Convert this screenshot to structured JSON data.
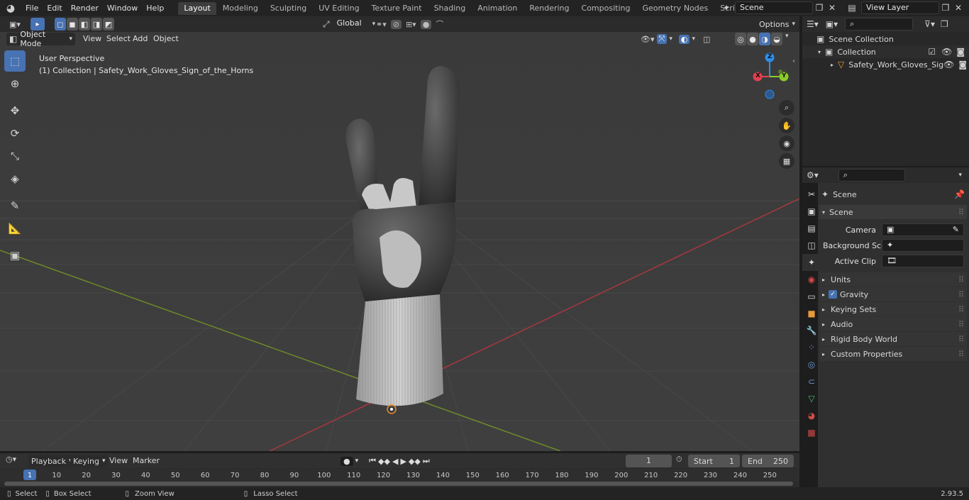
{
  "menubar": {
    "items": [
      "File",
      "Edit",
      "Render",
      "Window",
      "Help"
    ]
  },
  "workspaces": [
    "Layout",
    "Modeling",
    "Sculpting",
    "UV Editing",
    "Texture Paint",
    "Shading",
    "Animation",
    "Rendering",
    "Compositing",
    "Geometry Nodes",
    "Scripting"
  ],
  "active_workspace": "Layout",
  "scene_selector": "Scene",
  "view_layer": "View Layer",
  "viewport_header": {
    "mode": "Object Mode",
    "menus": [
      "View",
      "Select",
      "Add",
      "Object"
    ],
    "transform_orientation": "Global",
    "options": "Options"
  },
  "viewport": {
    "perspective_label": "User Perspective",
    "collection_label": "(1) Collection | Safety_Work_Gloves_Sign_of_the_Horns",
    "gizmo": {
      "z": "Z",
      "y": "Y",
      "x": "X"
    }
  },
  "outliner": {
    "scene_collection": "Scene Collection",
    "collection": "Collection",
    "object": "Safety_Work_Gloves_Sig"
  },
  "properties": {
    "context": "Scene",
    "panel_title": "Scene",
    "camera_label": "Camera",
    "background_scene_label": "Background Scene",
    "active_clip_label": "Active Clip",
    "subpanels": [
      "Units",
      "Gravity",
      "Keying Sets",
      "Audio",
      "Rigid Body World",
      "Custom Properties"
    ],
    "gravity_checked": true
  },
  "timeline": {
    "menus": [
      "Playback",
      "Keying",
      "View",
      "Marker"
    ],
    "current_frame": "1",
    "start_label": "Start",
    "start_value": "1",
    "end_label": "End",
    "end_value": "250",
    "ticks": [
      "1",
      "10",
      "20",
      "30",
      "40",
      "50",
      "60",
      "70",
      "80",
      "90",
      "100",
      "110",
      "120",
      "130",
      "140",
      "150",
      "160",
      "170",
      "180",
      "190",
      "200",
      "210",
      "220",
      "230",
      "240",
      "250"
    ]
  },
  "statusbar": {
    "select": "Select",
    "box_select": "Box Select",
    "zoom_view": "Zoom View",
    "lasso_select": "Lasso Select",
    "version": "2.93.5"
  },
  "colors": {
    "accent": "#4772b3",
    "x_axis": "#e2404f",
    "y_axis": "#8acb2a",
    "z_axis": "#2d8ee8"
  }
}
